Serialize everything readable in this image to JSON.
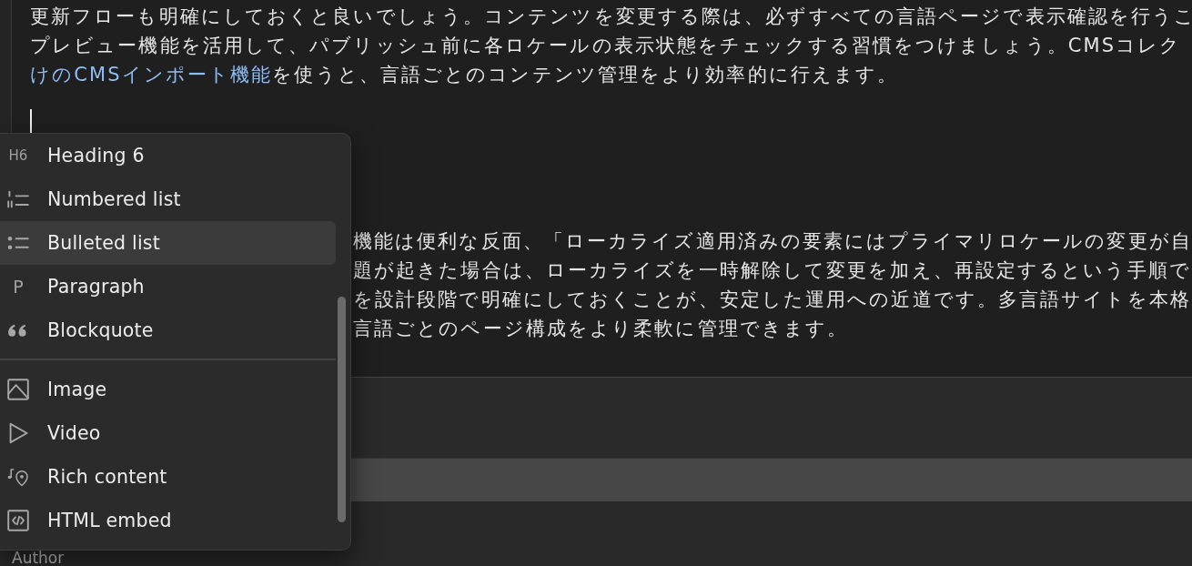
{
  "editor": {
    "blocks": [
      {
        "kind": "paragraph",
        "lines": [
          {
            "text": "更新フローも明確にしておくと良いでしょう。コンテンツを変更する際は、必ずすべての言語ページで表示確認を行うこ"
          },
          {
            "text": "プレビュー機能を活用して、パブリッシュ前に各ロケールの表示状態をチェックする習慣をつけましょう。CMSコレク"
          },
          {
            "link": "けのCMSインポート機能",
            "text": "を使うと、言語ごとのコンテンツ管理をより効率的に行えます。"
          }
        ]
      },
      {
        "kind": "empty",
        "caret": true
      },
      {
        "kind": "paragraph",
        "lines": [
          {
            "text": "機能は便利な反面、「ローカライズ適用済みの要素にはプライマリロケールの変更が自"
          },
          {
            "text": "題が起きた場合は、ローカライズを一時解除して変更を加え、再設定するという手順で"
          },
          {
            "text": "を設計段階で明確にしておくことが、安定した運用への近道です。多言語サイトを本格"
          },
          {
            "text": "言語ごとのページ構成をより柔軟に管理できます。"
          }
        ]
      }
    ]
  },
  "block_menu": {
    "groups": [
      {
        "items": [
          {
            "kind": "heading",
            "icon": "H6",
            "label": "Heading 6",
            "selected": false
          },
          {
            "kind": "numbered",
            "label": "Numbered list",
            "selected": false
          },
          {
            "kind": "bulleted",
            "label": "Bulleted list",
            "selected": true
          },
          {
            "kind": "paragraph",
            "icon": "P",
            "label": "Paragraph",
            "selected": false
          },
          {
            "kind": "blockquote",
            "label": "Blockquote",
            "selected": false
          }
        ]
      },
      {
        "items": [
          {
            "kind": "image",
            "label": "Image",
            "selected": false
          },
          {
            "kind": "video",
            "label": "Video",
            "selected": false
          },
          {
            "kind": "rich",
            "label": "Rich content",
            "selected": false
          },
          {
            "kind": "embed",
            "label": "HTML embed",
            "selected": false
          }
        ]
      }
    ]
  },
  "author_field": {
    "label": "Author"
  }
}
